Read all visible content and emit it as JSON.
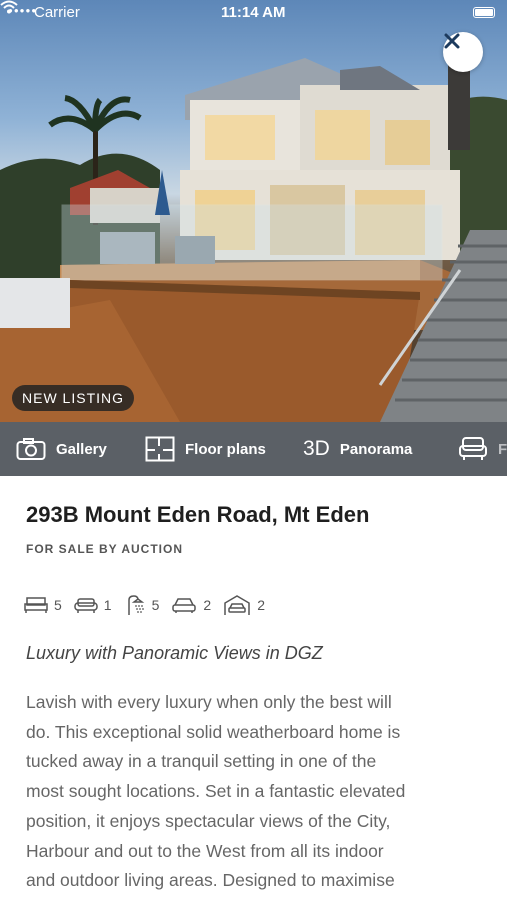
{
  "status_bar": {
    "carrier": "Carrier",
    "time": "11:14 AM"
  },
  "hero": {
    "badge": "NEW LISTING",
    "icons": {
      "close": "close-icon"
    }
  },
  "media_tabs": [
    {
      "label": "Gallery",
      "icon": "camera-icon"
    },
    {
      "label": "Floor plans",
      "icon": "floor-plan-icon"
    },
    {
      "prefix": "3D",
      "label": "Panorama",
      "icon": "3d-icon"
    },
    {
      "label": "F",
      "icon": "armchair-icon"
    }
  ],
  "listing": {
    "address": "293B Mount Eden Road, Mt Eden",
    "sale_method": "FOR SALE BY AUCTION",
    "features": [
      {
        "icon": "bed-icon",
        "count": "5"
      },
      {
        "icon": "sofa-icon",
        "count": "1"
      },
      {
        "icon": "shower-icon",
        "count": "5"
      },
      {
        "icon": "car-icon",
        "count": "2"
      },
      {
        "icon": "garage-icon",
        "count": "2"
      }
    ],
    "headline": "Luxury with Panoramic Views in DGZ",
    "description_lines": [
      "Lavish with every luxury when only the best will",
      "do. This exceptional solid weatherboard home is",
      "tucked away in a tranquil setting in one of the",
      "most sought locations. Set in a fantastic elevated",
      "position, it enjoys spectacular views of the City,",
      "Harbour and out to the West from all its indoor",
      "and outdoor living areas. Designed to maximise"
    ]
  }
}
